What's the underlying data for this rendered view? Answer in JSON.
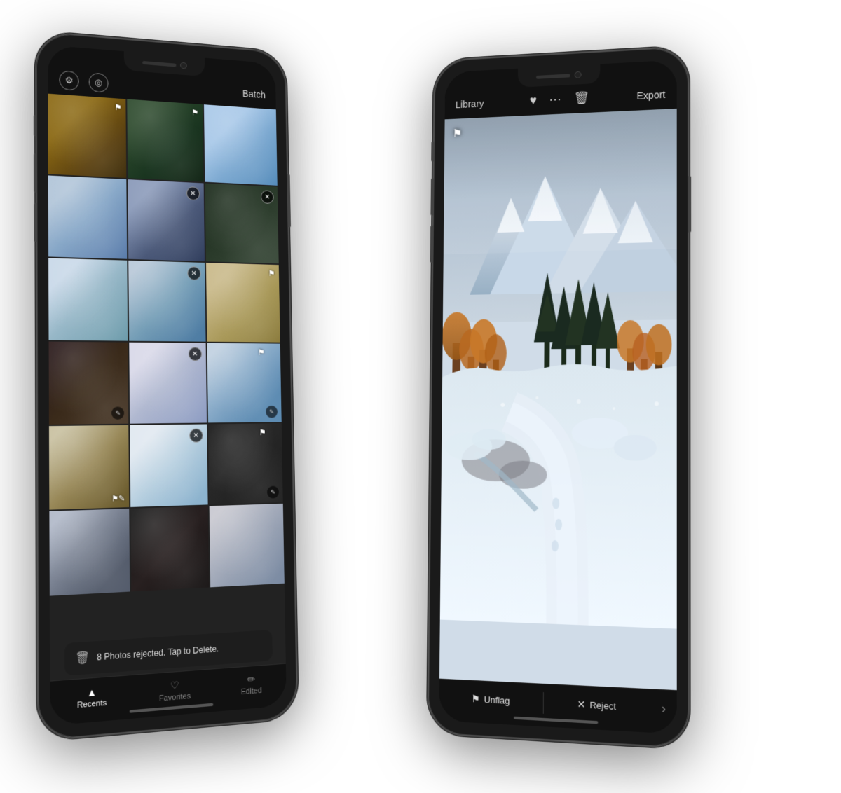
{
  "phone1": {
    "header": {
      "batch_label": "Batch"
    },
    "delete_bar": {
      "text": "8 Photos rejected. Tap to Delete."
    },
    "tab_bar": {
      "items": [
        {
          "id": "recents",
          "label": "Recents",
          "icon": "▲",
          "active": true
        },
        {
          "id": "favorites",
          "label": "Favorites",
          "icon": "♡",
          "active": false
        },
        {
          "id": "edited",
          "label": "Edited",
          "icon": "✏",
          "active": false
        }
      ]
    }
  },
  "phone2": {
    "header": {
      "library_label": "Library",
      "export_label": "Export"
    },
    "action_bar": {
      "unflag_label": "Unflag",
      "reject_label": "Reject"
    }
  }
}
